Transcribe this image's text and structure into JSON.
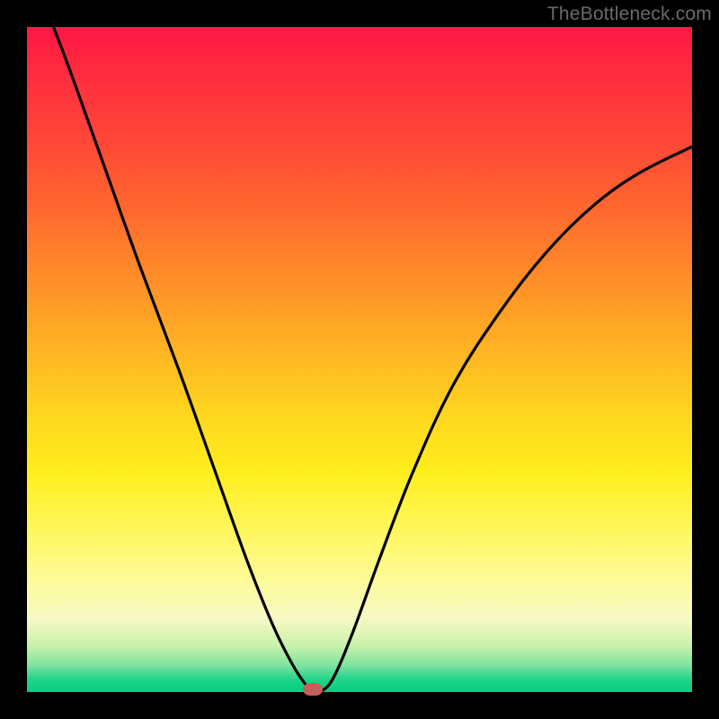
{
  "watermark": "TheBottleneck.com",
  "colors": {
    "frame_bg": "#000000",
    "gradient_top": "#ff1744",
    "gradient_mid": "#ffee1d",
    "gradient_bottom": "#00cf84",
    "curve": "#000000",
    "marker": "#c1615b"
  },
  "chart_data": {
    "type": "line",
    "title": "",
    "xlabel": "",
    "ylabel": "",
    "xlim": [
      0,
      100
    ],
    "ylim": [
      0,
      100
    ],
    "curve_points": [
      {
        "x": 4,
        "y": 100
      },
      {
        "x": 7,
        "y": 92
      },
      {
        "x": 12,
        "y": 78
      },
      {
        "x": 17,
        "y": 64
      },
      {
        "x": 23,
        "y": 48
      },
      {
        "x": 28,
        "y": 34
      },
      {
        "x": 33,
        "y": 20
      },
      {
        "x": 37,
        "y": 10
      },
      {
        "x": 40,
        "y": 4
      },
      {
        "x": 42,
        "y": 1
      },
      {
        "x": 43,
        "y": 0
      },
      {
        "x": 44,
        "y": 0
      },
      {
        "x": 46,
        "y": 2
      },
      {
        "x": 49,
        "y": 9
      },
      {
        "x": 53,
        "y": 20
      },
      {
        "x": 58,
        "y": 33
      },
      {
        "x": 64,
        "y": 46
      },
      {
        "x": 71,
        "y": 57
      },
      {
        "x": 78,
        "y": 66
      },
      {
        "x": 85,
        "y": 73
      },
      {
        "x": 92,
        "y": 78
      },
      {
        "x": 100,
        "y": 82
      }
    ],
    "marker": {
      "x": 43,
      "y": 0
    },
    "annotations": []
  }
}
